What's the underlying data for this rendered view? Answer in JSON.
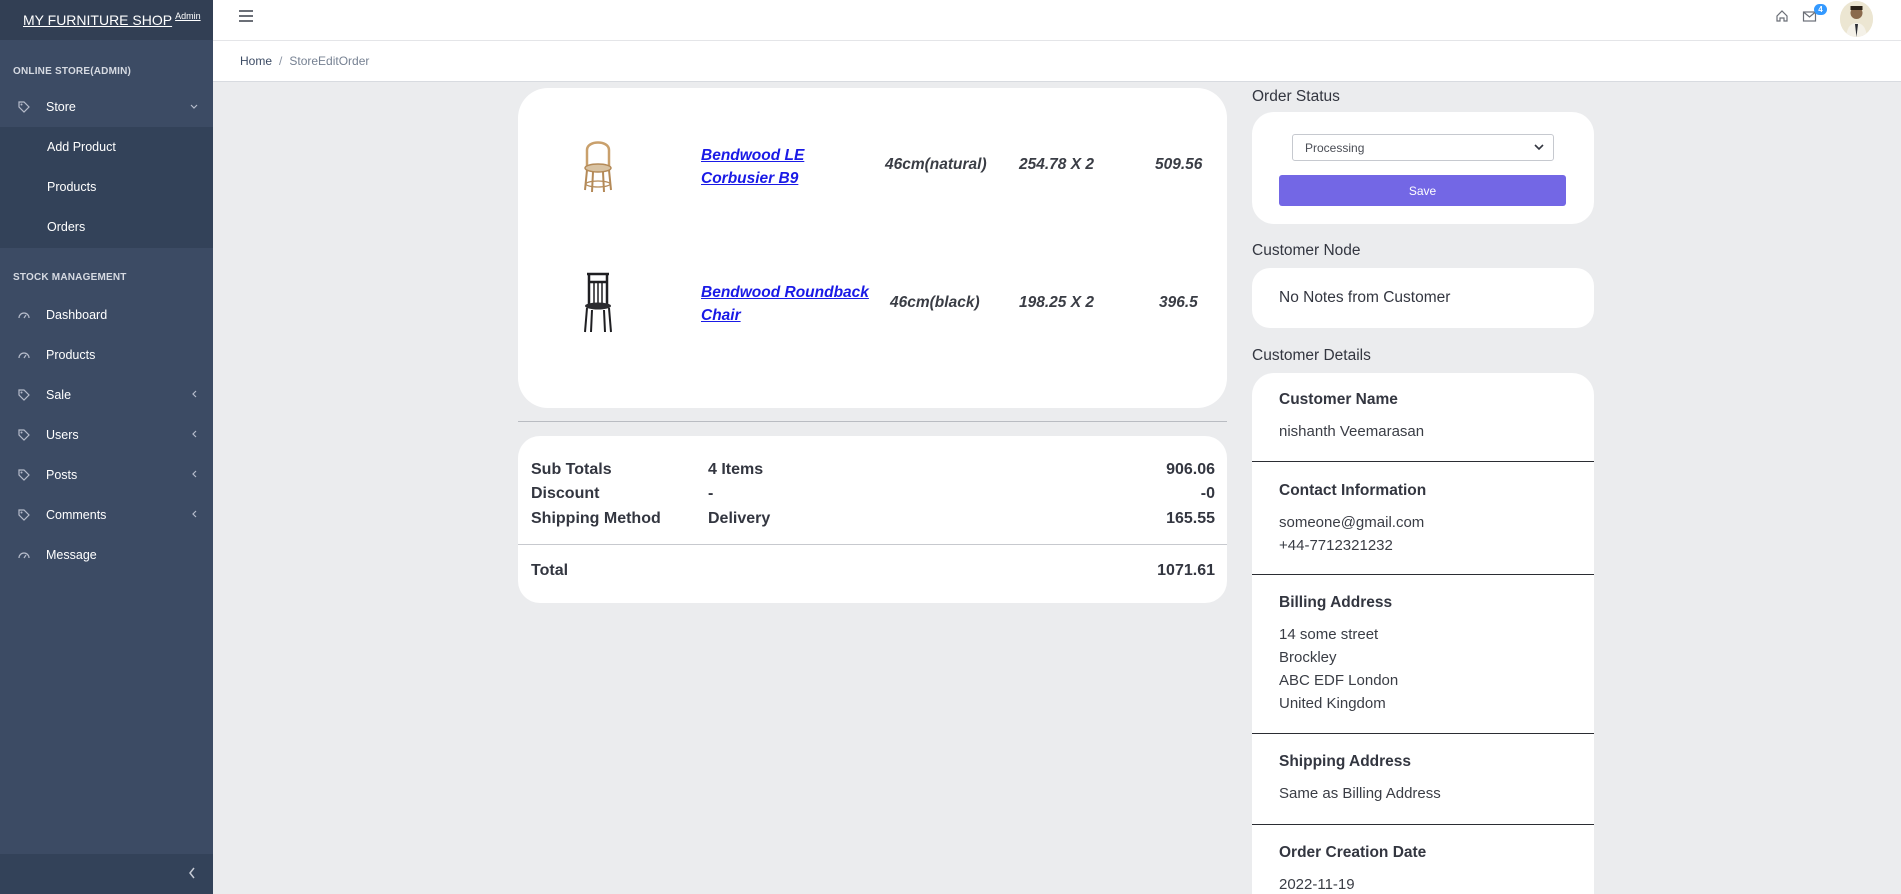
{
  "sidebar": {
    "brand": "MY FURNITURE SHOP",
    "brand_sup": "Admin",
    "section_store": "ONLINE STORE(ADMIN)",
    "store_label": "Store",
    "store_sub": [
      "Add Product",
      "Products",
      "Orders"
    ],
    "section_stock": "STOCK MANAGEMENT",
    "stock_items": [
      "Dashboard",
      "Products",
      "Sale",
      "Users",
      "Posts",
      "Comments",
      "Message"
    ]
  },
  "header": {
    "mail_badge": "4"
  },
  "breadcrumb": {
    "home": "Home",
    "sep": "/",
    "current": "StoreEditOrder"
  },
  "order": {
    "items": [
      {
        "name_line1": "Bendwood LE",
        "name_line2": "Corbusier B9",
        "size": "46cm(natural)",
        "qty": "254.78 X 2",
        "total": "509.56"
      },
      {
        "name_line1": "Bendwood Roundback",
        "name_line2": "Chair",
        "size": "46cm(black)",
        "qty": "198.25 X 2",
        "total": "396.5"
      }
    ],
    "totals": {
      "subtotal_label": "Sub Totals",
      "subtotal_items": "4 Items",
      "subtotal_value": "906.06",
      "discount_label": "Discount",
      "discount_mid": "-",
      "discount_value": "-0",
      "shipping_label": "Shipping Method",
      "shipping_mid": "Delivery",
      "shipping_value": "165.55",
      "total_label": "Total",
      "total_value": "1071.61"
    }
  },
  "status": {
    "title": "Order Status",
    "selected": "Processing",
    "save_label": "Save"
  },
  "notes": {
    "title": "Customer Node",
    "text": "No Notes from Customer"
  },
  "customer": {
    "title": "Customer Details",
    "name_label": "Customer Name",
    "name": "nishanth Veemarasan",
    "contact_label": "Contact Information",
    "email": "someone@gmail.com",
    "phone": "+44-7712321232",
    "billing_label": "Billing Address",
    "billing": [
      "14 some street",
      "Brockley",
      "ABC EDF London",
      "United Kingdom"
    ],
    "shipping_label": "Shipping Address",
    "shipping": "Same as Billing Address",
    "date_label": "Order Creation Date",
    "date": "2022-11-19"
  }
}
